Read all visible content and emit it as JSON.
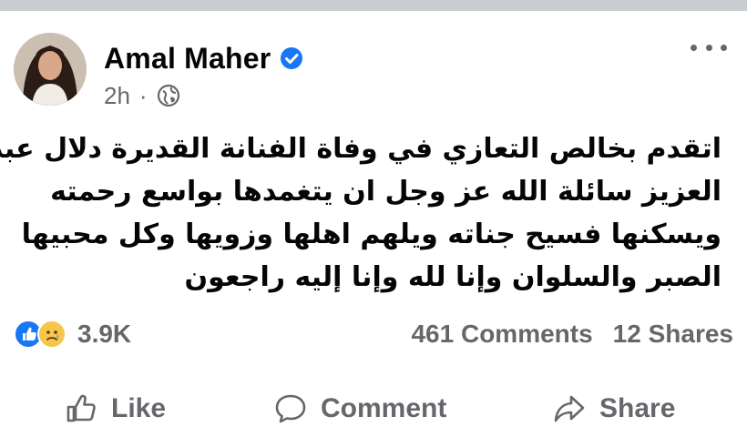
{
  "post": {
    "author": "Amal Maher",
    "time": "2h",
    "separator": "·",
    "text_lines": [
      "اتقدم بخالص التعازي في وفاة الفنانة القديرة دلال عبد",
      "العزيز سائلة الله عز وجل ان يتغمدها بواسع رحمته",
      "ويسكنها فسيح جناته ويلهم اهلها وزويها وكل محبيها",
      "الصبر والسلوان وإنا لله وإنا إليه راجعون"
    ]
  },
  "stats": {
    "reactions_count": "3.9K",
    "comments": "461 Comments",
    "shares": "12 Shares"
  },
  "actions": {
    "like": "Like",
    "comment": "Comment",
    "share": "Share"
  },
  "icons": {
    "verified": "verified-badge-icon",
    "audience": "globe-icon",
    "more": "more-options-icon",
    "reaction_like": "like-reaction-icon",
    "reaction_sad": "sad-reaction-icon"
  },
  "colors": {
    "accent": "#1877f2",
    "secondary_text": "#65676b",
    "sad_yellow": "#f7c54a"
  }
}
